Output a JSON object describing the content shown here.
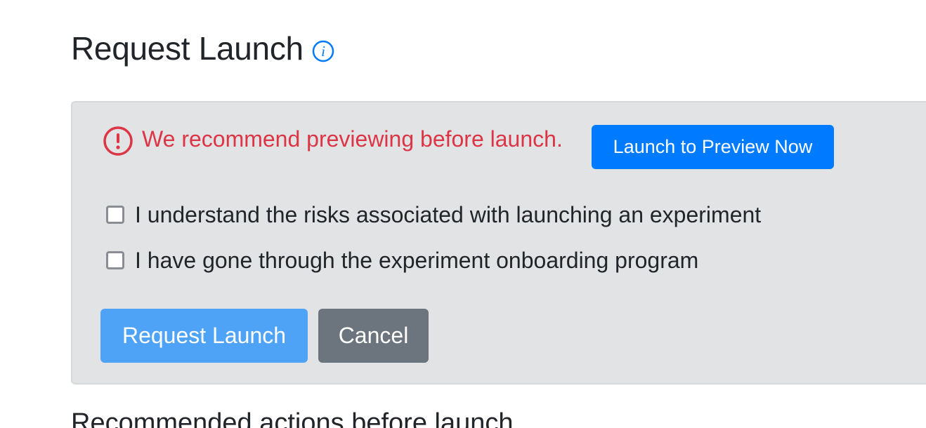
{
  "header": {
    "title": "Request Launch",
    "info_icon": "info-circle-icon"
  },
  "alert": {
    "icon": "exclamation-circle-icon",
    "message": "We recommend previewing before launch.",
    "preview_button_label": "Launch to Preview Now"
  },
  "checklist": [
    {
      "label": "I understand the risks associated with launching an experiment",
      "checked": false
    },
    {
      "label": "I have gone through the experiment onboarding program",
      "checked": false
    }
  ],
  "actions": {
    "request_label": "Request Launch",
    "cancel_label": "Cancel"
  },
  "next_section": {
    "heading": "Recommended actions before launch"
  },
  "colors": {
    "primary": "#007bff",
    "primary_disabled": "#4fa3f7",
    "secondary": "#6c757d",
    "danger": "#dc3545",
    "panel_bg": "#e2e3e5"
  }
}
